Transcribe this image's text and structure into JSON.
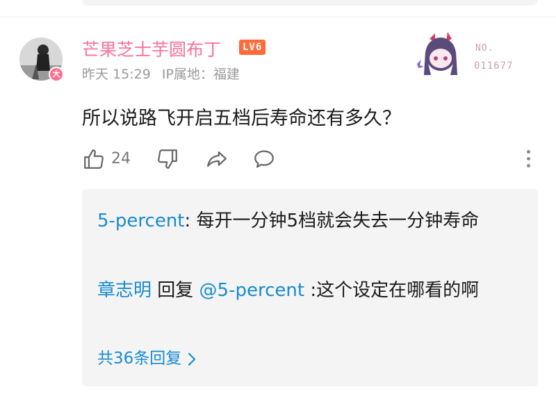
{
  "comment": {
    "username": "芒果芝士芋圆布丁",
    "level": "LV6",
    "time": "昨天 15:29",
    "ip_location": "IP属地：福建",
    "avatar_badge": "大",
    "fan_badge": {
      "label": "NO.",
      "number": "011677"
    },
    "text": "所以说路飞开启五档后寿命还有多久？",
    "likes": "24",
    "actions": [
      "like-icon",
      "dislike-icon",
      "share-icon",
      "reply-icon",
      "more-icon"
    ]
  },
  "replies": [
    {
      "user": "5-percent",
      "separator": ": ",
      "text": "每开一分钟5档就会失去一分钟寿命"
    },
    {
      "user": "章志明",
      "reply_word": " 回复 ",
      "mention": "@5-percent",
      "text": " :这个设定在哪看的啊"
    }
  ],
  "reply_count": "共36条回复",
  "colors": {
    "username": "#fb7299",
    "link": "#178bcf",
    "level_badge": "#ff6b3b",
    "reply_bg": "#f4f4f4"
  }
}
